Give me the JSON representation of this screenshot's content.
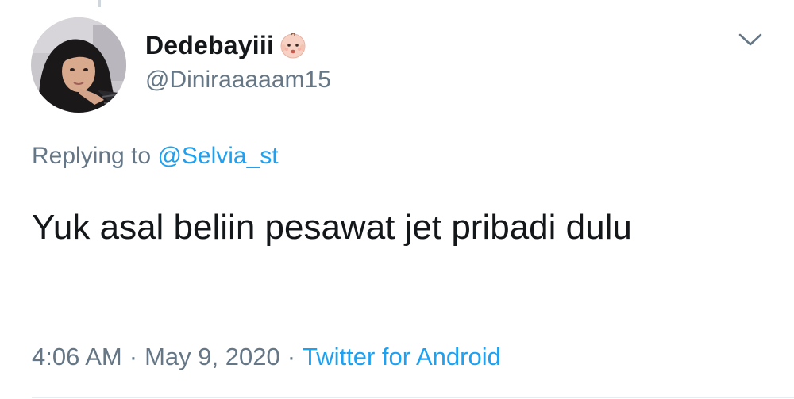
{
  "tweet": {
    "author": {
      "display_name": "Dedebayiii",
      "name_emoji_icon": "baby-face-icon",
      "handle": "@Diniraaaaam15",
      "avatar_icon": "user-avatar-photo"
    },
    "menu_icon": "chevron-down-icon",
    "reply_context": {
      "prefix": "Replying to",
      "mention": "@Selvia_st"
    },
    "text": "Yuk asal beliin pesawat jet pribadi dulu",
    "time": "4:06 AM",
    "separator": "·",
    "date": "May 9, 2020",
    "source": "Twitter for Android"
  },
  "colors": {
    "link_blue": "#1da1f2",
    "secondary_gray": "#657786",
    "primary_text": "#14171a",
    "divider": "#e6ecf0"
  }
}
